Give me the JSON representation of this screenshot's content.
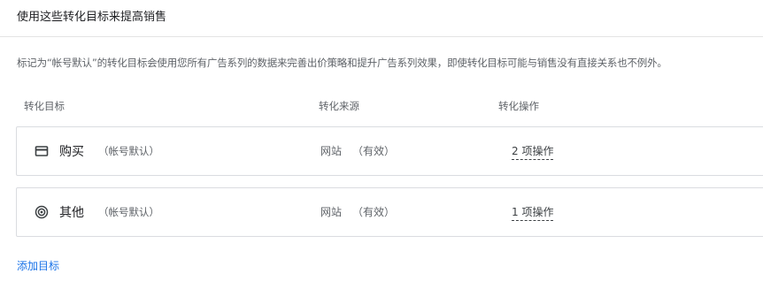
{
  "section": {
    "title": "使用这些转化目标来提高销售",
    "description": "标记为“帐号默认”的转化目标会使用您所有广告系列的数据来完善出价策略和提升广告系列效果，即使转化目标可能与销售没有直接关系也不例外。"
  },
  "table": {
    "headers": [
      "转化目标",
      "转化来源",
      "转化操作"
    ],
    "rows": [
      {
        "icon": "credit-card-icon",
        "name": "购买",
        "tag": "（帐号默认）",
        "source": "网站",
        "source_state": "（有效）",
        "actions": "2 项操作"
      },
      {
        "icon": "target-icon",
        "name": "其他",
        "tag": "（帐号默认）",
        "source": "网站",
        "source_state": "（有效）",
        "actions": "1 项操作"
      }
    ]
  },
  "add_goal_label": "添加目标",
  "colors": {
    "link": "#1a73e8",
    "border": "#dadce0",
    "text": "#3c4043"
  }
}
